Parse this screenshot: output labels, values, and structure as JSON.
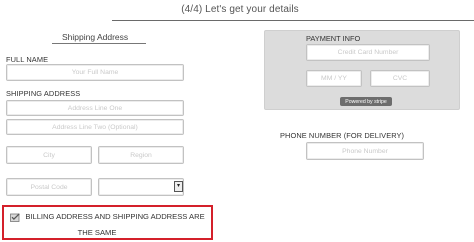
{
  "header": {
    "step_title": "(4/4) Let's get your details"
  },
  "shipping": {
    "title": "Shipping Address",
    "full_name_label": "FULL NAME",
    "full_name_placeholder": "Your Full Name",
    "address_label": "SHIPPING ADDRESS",
    "address1_placeholder": "Address Line One",
    "address2_placeholder": "Address Line Two (Optional)",
    "city_placeholder": "City",
    "region_placeholder": "Region",
    "postal_placeholder": "Postal Code",
    "country_value": ""
  },
  "payment": {
    "title": "PAYMENT INFO",
    "card_placeholder": "Credit Card Number",
    "expiry_placeholder": "MM / YY",
    "cvc_placeholder": "CVC",
    "powered_by": "Powered by stripe"
  },
  "phone": {
    "label": "PHONE NUMBER (FOR DELIVERY)",
    "placeholder": "Phone Number"
  },
  "billing": {
    "same_line1": "BILLING ADDRESS AND SHIPPING ADDRESS ARE",
    "same_line2": "THE SAME",
    "checked": true
  },
  "icons": {
    "select_arrow": "chevron-down-icon",
    "checkbox": "checkbox-icon"
  },
  "colors": {
    "highlight_border": "#d4202a",
    "payment_panel": "#dcdcdc",
    "powered_badge": "#6d6d6d"
  }
}
